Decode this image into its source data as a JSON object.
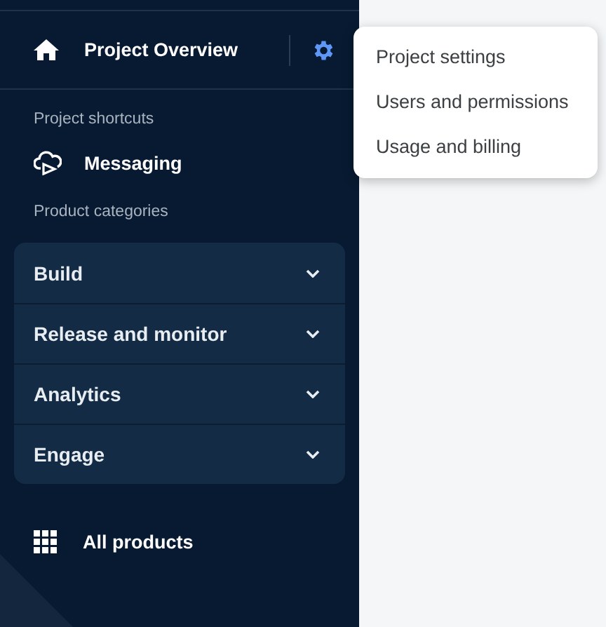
{
  "sidebar": {
    "header": {
      "title": "Project Overview"
    },
    "shortcuts_label": "Project shortcuts",
    "shortcuts": [
      {
        "label": "Messaging"
      }
    ],
    "categories_label": "Product categories",
    "categories": [
      {
        "label": "Build",
        "expanded": false
      },
      {
        "label": "Release and monitor",
        "expanded": false
      },
      {
        "label": "Analytics",
        "expanded": false
      },
      {
        "label": "Engage",
        "expanded": false
      }
    ],
    "all_products": "All products"
  },
  "settings_menu": {
    "open": true,
    "items": [
      {
        "label": "Project settings"
      },
      {
        "label": "Users and permissions"
      },
      {
        "label": "Usage and billing"
      }
    ]
  }
}
